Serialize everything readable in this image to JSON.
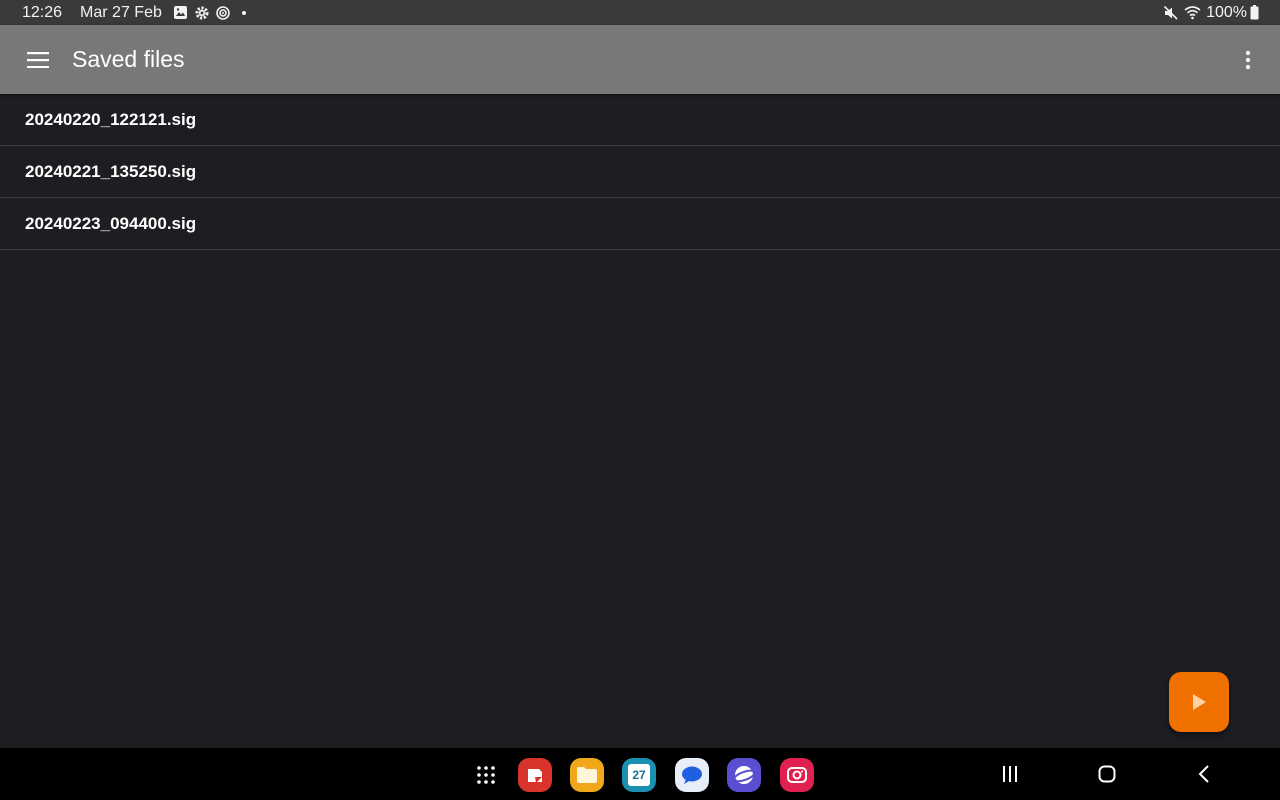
{
  "status_bar": {
    "time": "12:26",
    "date": "Mar 27 Feb",
    "battery": "100%",
    "left_icons": [
      "gallery-icon",
      "settings-icon",
      "sync-icon",
      "dot-icon"
    ],
    "right_icons": [
      "mute-icon",
      "wifi-icon",
      "battery-icon"
    ]
  },
  "app_bar": {
    "title": "Saved files",
    "menu_icon": "hamburger-menu-icon",
    "overflow_icon": "more-vert-icon",
    "color": "#787878"
  },
  "files": [
    {
      "name": "20240220_122121.sig"
    },
    {
      "name": "20240221_135250.sig"
    },
    {
      "name": "20240223_094400.sig"
    }
  ],
  "fab": {
    "icon": "play-icon",
    "color": "#f07000"
  },
  "dock": {
    "apps": [
      {
        "name": "app-drawer",
        "icon": "grid-icon"
      },
      {
        "name": "notes",
        "icon": "notes-icon",
        "color": "#d9342b"
      },
      {
        "name": "my-files",
        "icon": "folder-icon",
        "color": "#f0a71a"
      },
      {
        "name": "calendar",
        "icon": "calendar-icon",
        "color": "#1b8fb0",
        "label": "27"
      },
      {
        "name": "messages",
        "icon": "chat-icon",
        "color": "#e8eef8"
      },
      {
        "name": "internet",
        "icon": "browser-icon",
        "color": "#5a4fd0"
      },
      {
        "name": "camera",
        "icon": "camera-icon",
        "color": "#e0204f"
      }
    ],
    "nav_keys": [
      "recents-icon",
      "home-icon",
      "back-icon"
    ]
  },
  "colors": {
    "background": "#1e1e22",
    "divider": "#3a3a3e",
    "status_bar": "#3a3a3d",
    "nav_bar": "#000000"
  }
}
